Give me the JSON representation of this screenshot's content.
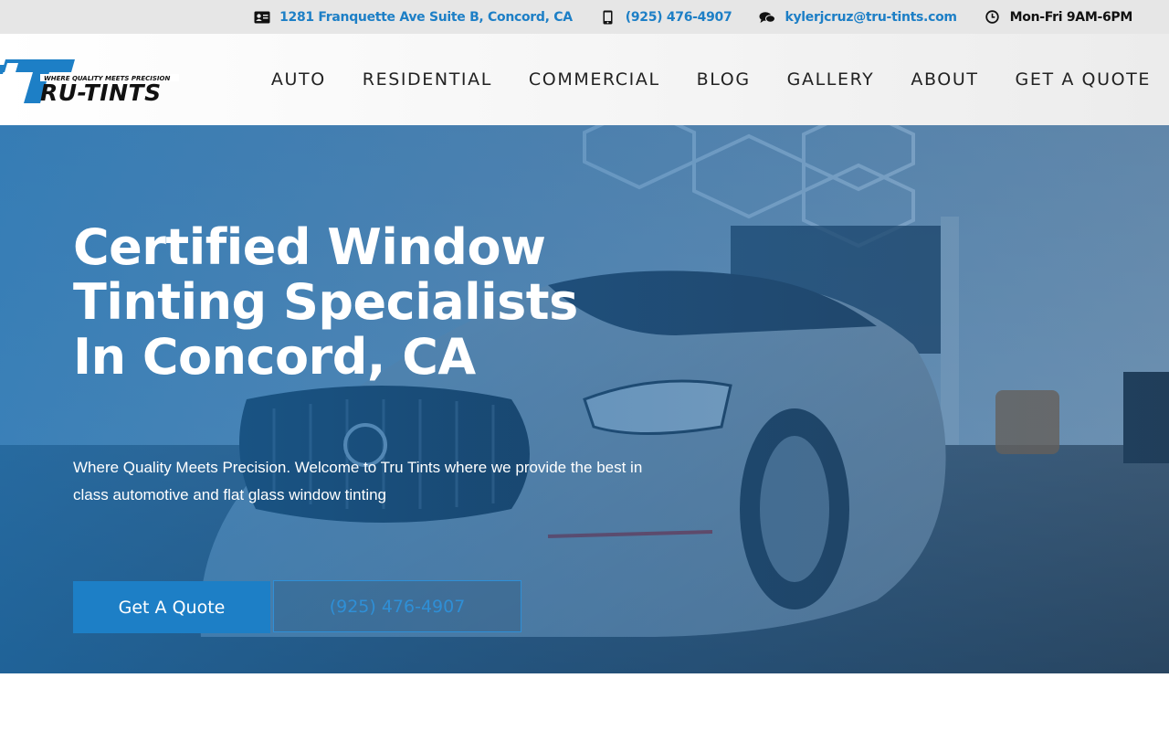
{
  "topbar": {
    "address": "1281 Franquette Ave Suite B, Concord, CA",
    "phone": "(925) 476-4907",
    "email": "kylerjcruz@tru-tints.com",
    "hours": "Mon-Fri 9AM-6PM",
    "icons": [
      "id-card-icon",
      "mobile-phone-icon",
      "chat-bubbles-icon",
      "clock-icon"
    ]
  },
  "logo": {
    "tagline": "WHERE QUALITY MEETS PRECISION",
    "wordmark": "RU-TINTS"
  },
  "nav": {
    "items": [
      {
        "label": "AUTO"
      },
      {
        "label": "RESIDENTIAL"
      },
      {
        "label": "COMMERCIAL"
      },
      {
        "label": "BLOG"
      },
      {
        "label": "GALLERY"
      },
      {
        "label": "ABOUT"
      },
      {
        "label": "GET A QUOTE"
      }
    ]
  },
  "hero": {
    "title_line1": "Certified Window",
    "title_line2": "Tinting Specialists",
    "title_line3": "In Concord, CA",
    "subtitle": "Where Quality Meets Precision. Welcome to Tru Tints where we provide the best in class automotive and flat glass window tinting",
    "cta_quote": "Get A Quote",
    "cta_phone": "(925) 476-4907"
  },
  "colors": {
    "accent": "#1d7fc6",
    "topbar_bg": "#e6e6e6",
    "hero_overlay": "#186db0",
    "text_dark": "#222222"
  }
}
